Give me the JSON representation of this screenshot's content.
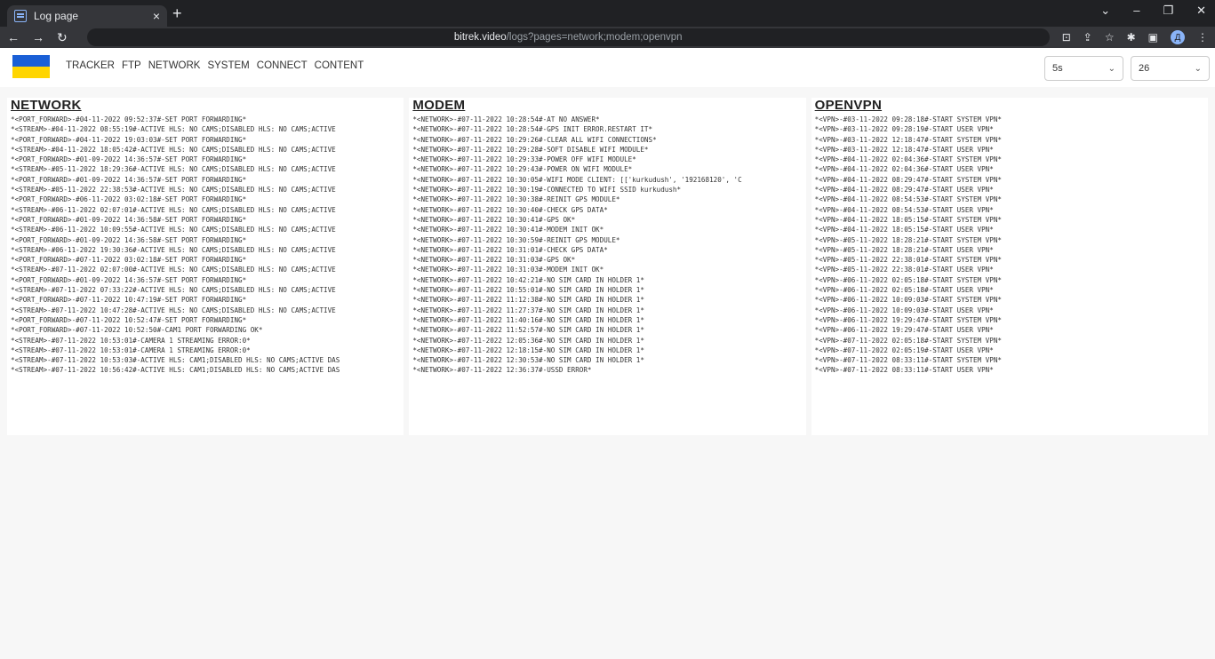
{
  "browser": {
    "tab_title": "Log page",
    "tab_close": "×",
    "new_tab": "+",
    "url_host": "bitrek.video",
    "url_path": "/logs?pages=network;modem;openvpn",
    "profile_initial": "Д",
    "window_controls": [
      "⌄",
      "–",
      "❐",
      "✕"
    ]
  },
  "nav": {
    "items": [
      "TRACKER",
      "FTP",
      "NETWORK",
      "SYSTEM",
      "CONNECT",
      "CONTENT"
    ],
    "refresh_value": "5s",
    "lines_value": "26"
  },
  "columns": {
    "network": {
      "title": "NETWORK",
      "lines": [
        "*<PORT_FORWARD>-#04-11-2022 09:52:37#-SET PORT FORWARDING*",
        "*<STREAM>-#04-11-2022 08:55:19#-ACTIVE HLS: NO CAMS;DISABLED HLS: NO CAMS;ACTIVE",
        "*<PORT_FORWARD>-#04-11-2022 19:03:03#-SET PORT FORWARDING*",
        "*<STREAM>-#04-11-2022 18:05:42#-ACTIVE HLS: NO CAMS;DISABLED HLS: NO CAMS;ACTIVE",
        "*<PORT_FORWARD>-#01-09-2022 14:36:57#-SET PORT FORWARDING*",
        "*<STREAM>-#05-11-2022 18:29:36#-ACTIVE HLS: NO CAMS;DISABLED HLS: NO CAMS;ACTIVE",
        "*<PORT_FORWARD>-#01-09-2022 14:36:57#-SET PORT FORWARDING*",
        "*<STREAM>-#05-11-2022 22:38:53#-ACTIVE HLS: NO CAMS;DISABLED HLS: NO CAMS;ACTIVE",
        "*<PORT_FORWARD>-#06-11-2022 03:02:18#-SET PORT FORWARDING*",
        "*<STREAM>-#06-11-2022 02:07:01#-ACTIVE HLS: NO CAMS;DISABLED HLS: NO CAMS;ACTIVE",
        "*<PORT_FORWARD>-#01-09-2022 14:36:58#-SET PORT FORWARDING*",
        "*<STREAM>-#06-11-2022 10:09:55#-ACTIVE HLS: NO CAMS;DISABLED HLS: NO CAMS;ACTIVE",
        "*<PORT_FORWARD>-#01-09-2022 14:36:58#-SET PORT FORWARDING*",
        "*<STREAM>-#06-11-2022 19:30:36#-ACTIVE HLS: NO CAMS;DISABLED HLS: NO CAMS;ACTIVE",
        "*<PORT_FORWARD>-#07-11-2022 03:02:18#-SET PORT FORWARDING*",
        "*<STREAM>-#07-11-2022 02:07:00#-ACTIVE HLS: NO CAMS;DISABLED HLS: NO CAMS;ACTIVE",
        "*<PORT_FORWARD>-#01-09-2022 14:36:57#-SET PORT FORWARDING*",
        "*<STREAM>-#07-11-2022 07:33:22#-ACTIVE HLS: NO CAMS;DISABLED HLS: NO CAMS;ACTIVE",
        "*<PORT_FORWARD>-#07-11-2022 10:47:19#-SET PORT FORWARDING*",
        "*<STREAM>-#07-11-2022 10:47:28#-ACTIVE HLS: NO CAMS;DISABLED HLS: NO CAMS;ACTIVE",
        "*<PORT_FORWARD>-#07-11-2022 10:52:47#-SET PORT FORWARDING*",
        "*<PORT_FORWARD>-#07-11-2022 10:52:50#-CAM1 PORT FORWARDING OK*",
        "*<STREAM>-#07-11-2022 10:53:01#-CAMERA 1 STREAMING ERROR:0*",
        "*<STREAM>-#07-11-2022 10:53:01#-CAMERA 1 STREAMING ERROR:0*",
        "*<STREAM>-#07-11-2022 10:53:03#-ACTIVE HLS: CAM1;DISABLED HLS: NO CAMS;ACTIVE DAS",
        "*<STREAM>-#07-11-2022 10:56:42#-ACTIVE HLS: CAM1;DISABLED HLS: NO CAMS;ACTIVE DAS"
      ]
    },
    "modem": {
      "title": "MODEM",
      "lines": [
        "*<NETWORK>-#07-11-2022 10:28:54#-AT NO ANSWER*",
        "*<NETWORK>-#07-11-2022 10:28:54#-GPS INIT ERROR.RESTART IT*",
        "*<NETWORK>-#07-11-2022 10:29:26#-CLEAR ALL WIFI CONNECTIONS*",
        "*<NETWORK>-#07-11-2022 10:29:28#-SOFT DISABLE WIFI MODULE*",
        "*<NETWORK>-#07-11-2022 10:29:33#-POWER OFF WIFI MODULE*",
        "*<NETWORK>-#07-11-2022 10:29:43#-POWER ON WIFI MODULE*",
        "*<NETWORK>-#07-11-2022 10:30:05#-WIFI MODE CLIENT: [['kurkudush', '192168120', 'C",
        "*<NETWORK>-#07-11-2022 10:30:19#-CONNECTED TO WIFI SSID kurkudush*",
        "*<NETWORK>-#07-11-2022 10:30:38#-REINIT GPS MODULE*",
        "*<NETWORK>-#07-11-2022 10:30:40#-CHECK GPS DATA*",
        "*<NETWORK>-#07-11-2022 10:30:41#-GPS OK*",
        "*<NETWORK>-#07-11-2022 10:30:41#-MODEM INIT OK*",
        "*<NETWORK>-#07-11-2022 10:30:59#-REINIT GPS MODULE*",
        "*<NETWORK>-#07-11-2022 10:31:01#-CHECK GPS DATA*",
        "*<NETWORK>-#07-11-2022 10:31:03#-GPS OK*",
        "*<NETWORK>-#07-11-2022 10:31:03#-MODEM INIT OK*",
        "*<NETWORK>-#07-11-2022 10:42:21#-NO SIM CARD IN HOLDER 1*",
        "*<NETWORK>-#07-11-2022 10:55:01#-NO SIM CARD IN HOLDER 1*",
        "*<NETWORK>-#07-11-2022 11:12:38#-NO SIM CARD IN HOLDER 1*",
        "*<NETWORK>-#07-11-2022 11:27:37#-NO SIM CARD IN HOLDER 1*",
        "*<NETWORK>-#07-11-2022 11:40:16#-NO SIM CARD IN HOLDER 1*",
        "*<NETWORK>-#07-11-2022 11:52:57#-NO SIM CARD IN HOLDER 1*",
        "*<NETWORK>-#07-11-2022 12:05:36#-NO SIM CARD IN HOLDER 1*",
        "*<NETWORK>-#07-11-2022 12:18:15#-NO SIM CARD IN HOLDER 1*",
        "*<NETWORK>-#07-11-2022 12:30:53#-NO SIM CARD IN HOLDER 1*",
        "*<NETWORK>-#07-11-2022 12:36:37#-USSD ERROR*"
      ]
    },
    "openvpn": {
      "title": "OPENVPN",
      "lines": [
        "*<VPN>-#03-11-2022 09:28:18#-START SYSTEM VPN*",
        "*<VPN>-#03-11-2022 09:28:19#-START USER VPN*",
        "*<VPN>-#03-11-2022 12:18:47#-START SYSTEM VPN*",
        "*<VPN>-#03-11-2022 12:18:47#-START USER VPN*",
        "*<VPN>-#04-11-2022 02:04:36#-START SYSTEM VPN*",
        "*<VPN>-#04-11-2022 02:04:36#-START USER VPN*",
        "*<VPN>-#04-11-2022 08:29:47#-START SYSTEM VPN*",
        "*<VPN>-#04-11-2022 08:29:47#-START USER VPN*",
        "*<VPN>-#04-11-2022 08:54:53#-START SYSTEM VPN*",
        "*<VPN>-#04-11-2022 08:54:53#-START USER VPN*",
        "*<VPN>-#04-11-2022 18:05:15#-START SYSTEM VPN*",
        "*<VPN>-#04-11-2022 18:05:15#-START USER VPN*",
        "*<VPN>-#05-11-2022 18:28:21#-START SYSTEM VPN*",
        "*<VPN>-#05-11-2022 18:28:21#-START USER VPN*",
        "*<VPN>-#05-11-2022 22:38:01#-START SYSTEM VPN*",
        "*<VPN>-#05-11-2022 22:38:01#-START USER VPN*",
        "*<VPN>-#06-11-2022 02:05:18#-START SYSTEM VPN*",
        "*<VPN>-#06-11-2022 02:05:18#-START USER VPN*",
        "*<VPN>-#06-11-2022 10:09:03#-START SYSTEM VPN*",
        "*<VPN>-#06-11-2022 10:09:03#-START USER VPN*",
        "*<VPN>-#06-11-2022 19:29:47#-START SYSTEM VPN*",
        "*<VPN>-#06-11-2022 19:29:47#-START USER VPN*",
        "*<VPN>-#07-11-2022 02:05:18#-START SYSTEM VPN*",
        "*<VPN>-#07-11-2022 02:05:19#-START USER VPN*",
        "*<VPN>-#07-11-2022 08:33:11#-START SYSTEM VPN*",
        "*<VPN>-#07-11-2022 08:33:11#-START USER VPN*"
      ]
    }
  }
}
